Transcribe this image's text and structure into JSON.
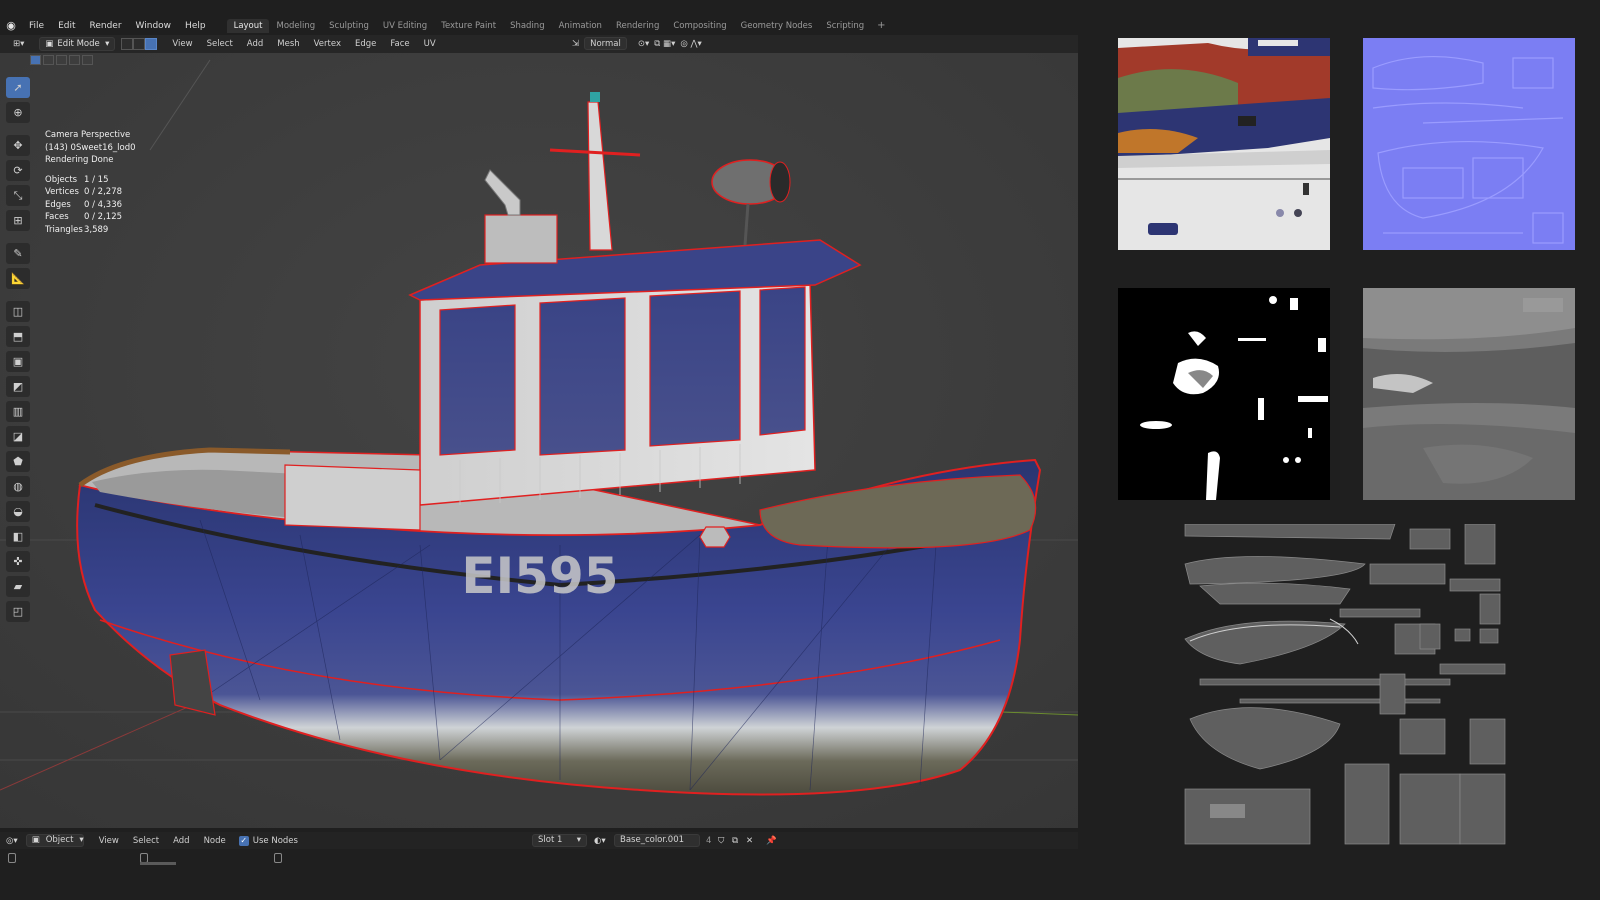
{
  "topbar": {
    "logo": "blender-logo",
    "menus": [
      "File",
      "Edit",
      "Render",
      "Window",
      "Help"
    ],
    "workspaces": [
      "Layout",
      "Modeling",
      "Sculpting",
      "UV Editing",
      "Texture Paint",
      "Shading",
      "Animation",
      "Rendering",
      "Compositing",
      "Geometry Nodes",
      "Scripting"
    ],
    "active_workspace": "Layout",
    "add_workspace": "+"
  },
  "viewport_header": {
    "mode": "Edit Mode",
    "menus": [
      "View",
      "Select",
      "Add",
      "Mesh",
      "Vertex",
      "Edge",
      "Face",
      "UV"
    ],
    "orientation": "Normal"
  },
  "overlay": {
    "view_name": "Camera Perspective",
    "object_name": "(143) 0Sweet16_lod0",
    "status": "Rendering Done",
    "stats": [
      {
        "label": "Objects",
        "value": "1 / 15"
      },
      {
        "label": "Vertices",
        "value": "0 / 2,278"
      },
      {
        "label": "Edges",
        "value": "0 / 4,336"
      },
      {
        "label": "Faces",
        "value": "0 / 2,125"
      },
      {
        "label": "Triangles",
        "value": "3,589"
      }
    ]
  },
  "hull_text": "EI595",
  "toolbar_icons": [
    "select-box-icon",
    "cursor-icon",
    "move-icon",
    "rotate-icon",
    "scale-icon",
    "transform-icon",
    "annotate-icon",
    "measure-icon",
    "add-cube-icon",
    "extrude-icon",
    "inset-icon",
    "bevel-icon",
    "loop-cut-icon",
    "knife-icon",
    "poly-build-icon",
    "spin-icon",
    "smooth-icon",
    "edge-slide-icon",
    "shrink-fatten-icon",
    "shear-icon",
    "rip-region-icon"
  ],
  "bottom_bar": {
    "editor_type": "Object",
    "menus": [
      "View",
      "Select",
      "Add",
      "Node"
    ],
    "use_nodes_label": "Use Nodes",
    "use_nodes_checked": true,
    "slot": "Slot 1",
    "material": "Base_color.001",
    "users": "4"
  },
  "colors": {
    "accent": "#4772b3",
    "hull_blue": "#2f3a78",
    "wire_red": "#e02020",
    "viewport_bg": "#3c3c3c"
  }
}
